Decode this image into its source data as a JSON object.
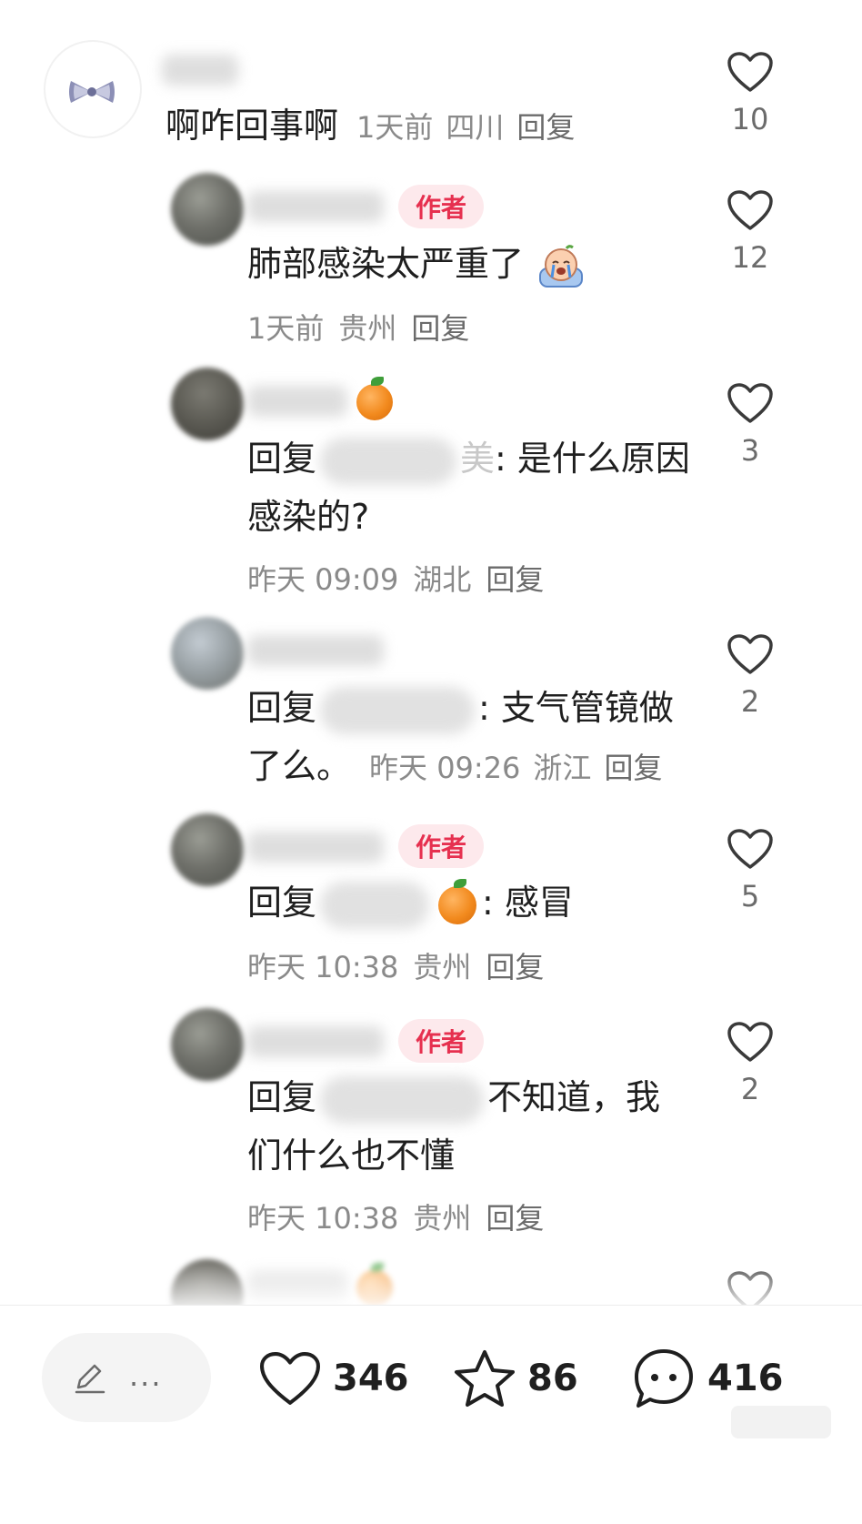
{
  "comments": [
    {
      "text": "啊咋回事啊",
      "time": "1天前",
      "location": "四川",
      "reply": "回复",
      "likes": "10"
    },
    {
      "tag": "作者",
      "text": "肺部感染太严重了",
      "emoji": "crying-face-emoji",
      "time": "1天前",
      "location": "贵州",
      "reply": "回复",
      "likes": "12"
    },
    {
      "prefix": "回复",
      "name_tail": "美",
      "text_line1": ": 是什么原因",
      "text_line2": "感染的?",
      "time": "昨天 09:09",
      "location": "湖北",
      "reply": "回复",
      "likes": "3"
    },
    {
      "prefix": "回复",
      "text_line1": ": 支气管镜做",
      "text_line2": "了么。",
      "time": "昨天 09:26",
      "location": "浙江",
      "reply": "回复",
      "likes": "2"
    },
    {
      "tag": "作者",
      "prefix": "回复",
      "text": ": 感冒",
      "time": "昨天 10:38",
      "location": "贵州",
      "reply": "回复",
      "likes": "5"
    },
    {
      "tag": "作者",
      "prefix": "回复",
      "text_line1": "不知道，我",
      "text_line2": "们什么也不懂",
      "time": "昨天 10:38",
      "location": "贵州",
      "reply": "回复",
      "likes": "2"
    }
  ],
  "bottom_bar": {
    "input_placeholder": "...",
    "likes": "346",
    "favorites": "86",
    "comments": "416"
  },
  "colors": {
    "author_tag_text": "#e6304f",
    "author_tag_bg": "#fde9ec",
    "meta_text": "#8a8a8a"
  }
}
